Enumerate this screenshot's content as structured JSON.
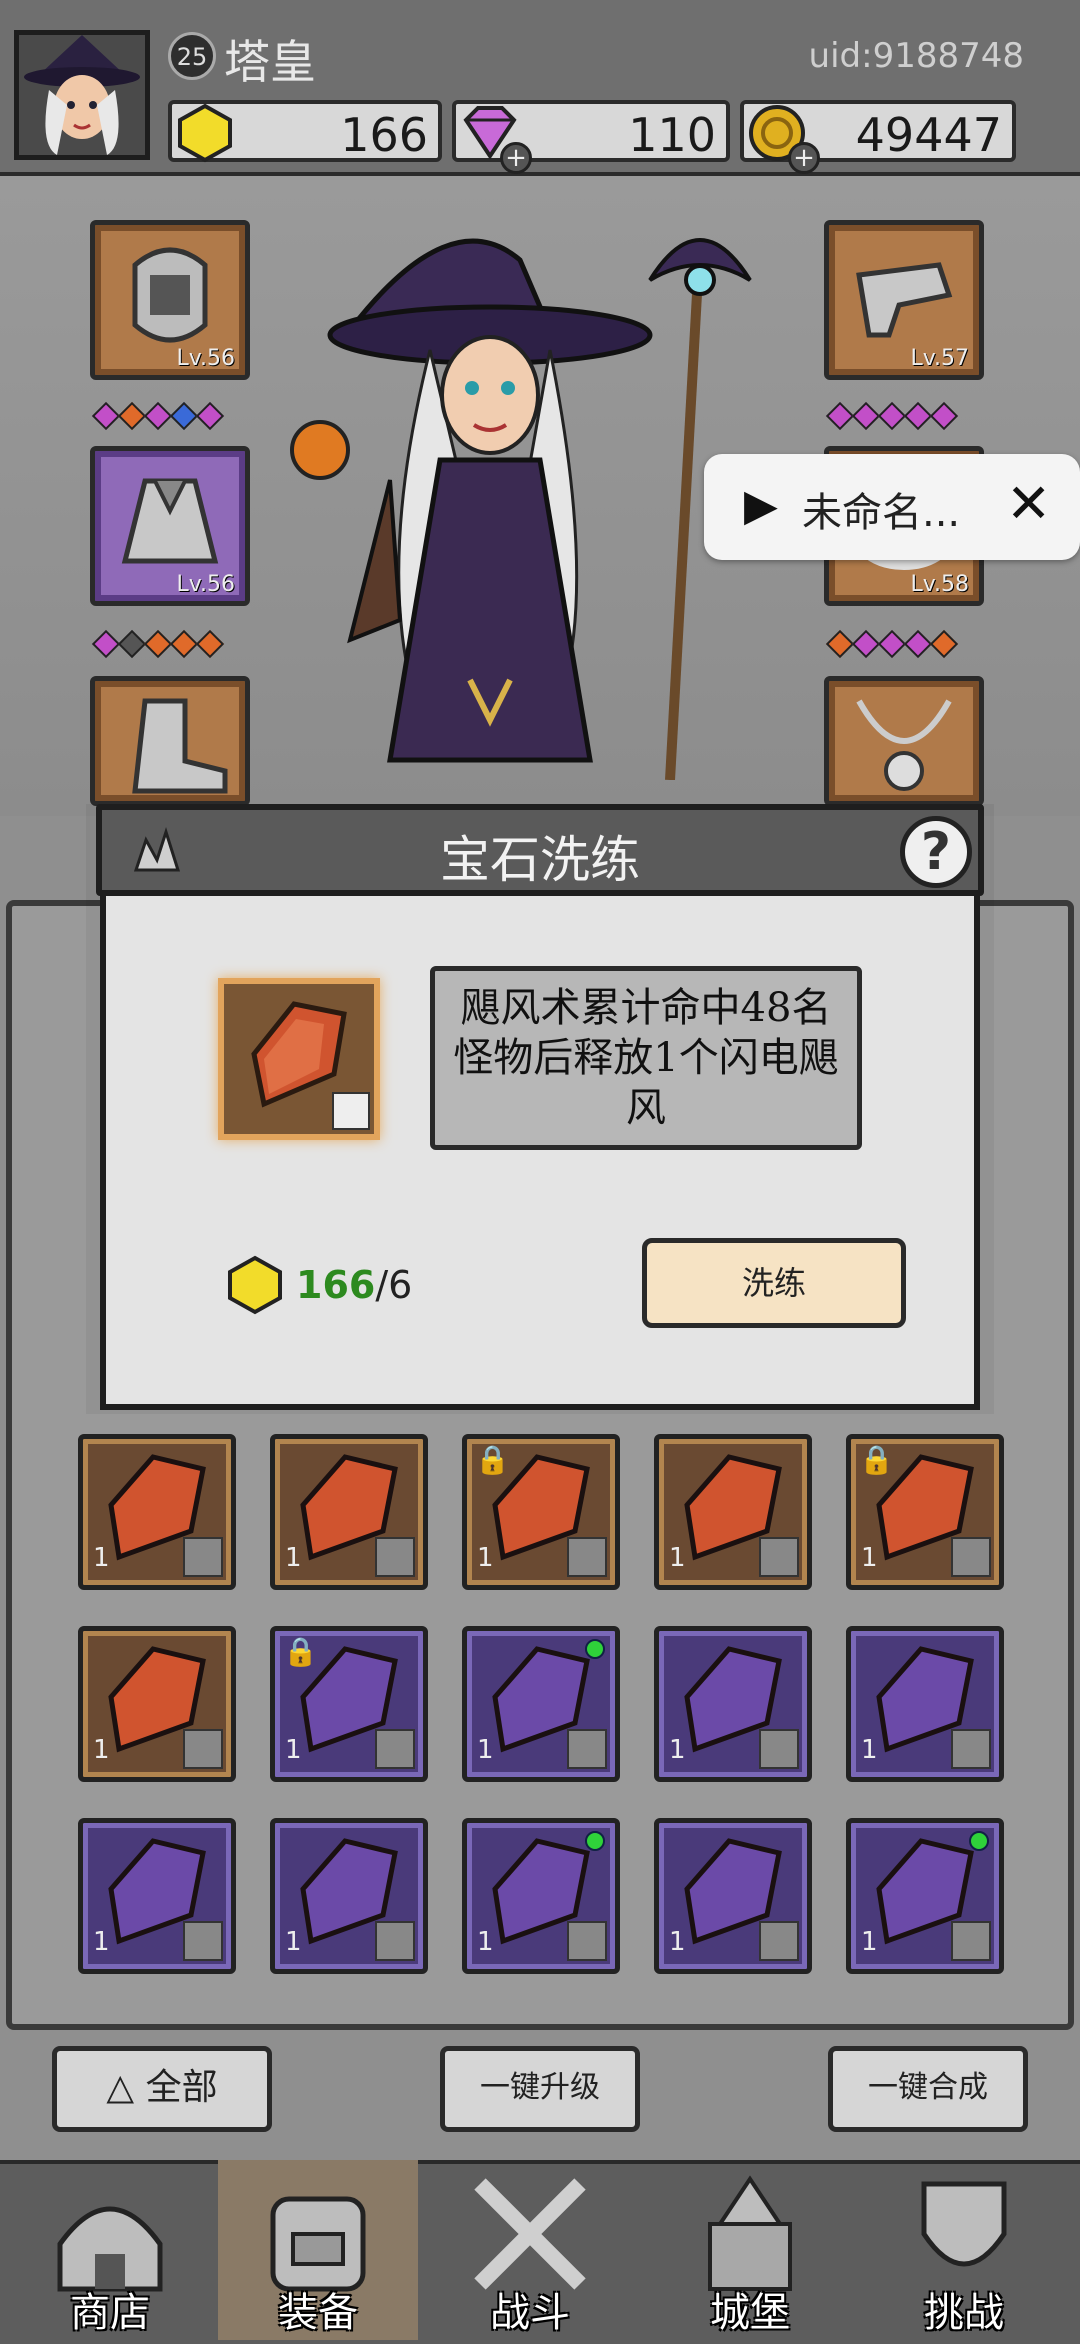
{
  "player": {
    "level": "25",
    "name": "塔皇",
    "uid": "uid:9188748"
  },
  "resources": {
    "gold_gem": "166",
    "diamond": "110",
    "coin": "49447"
  },
  "equipment_slots": [
    {
      "name": "helmet",
      "level": "Lv.56"
    },
    {
      "name": "cloak",
      "level": "Lv.56"
    },
    {
      "name": "boots",
      "level": ""
    },
    {
      "name": "gauntlet",
      "level": "Lv.57"
    },
    {
      "name": "ring",
      "level": "Lv.58"
    },
    {
      "name": "amulet",
      "level": ""
    }
  ],
  "notification": {
    "label": "未命名..."
  },
  "modal": {
    "title": "宝石洗练",
    "help": "?",
    "description": "飓风术累计命中48名怪物后释放1个闪电飓风",
    "cost_have": "166",
    "cost_need": "/6",
    "refine_button": "洗练"
  },
  "gem_grid": [
    {
      "color": "orange",
      "count": "1",
      "locked": false,
      "new": false
    },
    {
      "color": "orange",
      "count": "1",
      "locked": false,
      "new": false
    },
    {
      "color": "orange",
      "count": "1",
      "locked": true,
      "new": false
    },
    {
      "color": "orange",
      "count": "1",
      "locked": false,
      "new": false
    },
    {
      "color": "orange",
      "count": "1",
      "locked": true,
      "new": false
    },
    {
      "color": "orange",
      "count": "1",
      "locked": false,
      "new": false
    },
    {
      "color": "purple",
      "count": "1",
      "locked": true,
      "new": false
    },
    {
      "color": "purple",
      "count": "1",
      "locked": false,
      "new": true
    },
    {
      "color": "purple",
      "count": "1",
      "locked": false,
      "new": false
    },
    {
      "color": "purple",
      "count": "1",
      "locked": false,
      "new": false
    },
    {
      "color": "purple",
      "count": "1",
      "locked": false,
      "new": false
    },
    {
      "color": "purple",
      "count": "1",
      "locked": false,
      "new": false
    },
    {
      "color": "purple",
      "count": "1",
      "locked": false,
      "new": true
    },
    {
      "color": "purple",
      "count": "1",
      "locked": false,
      "new": false
    },
    {
      "color": "purple",
      "count": "1",
      "locked": false,
      "new": true
    }
  ],
  "bottom_buttons": {
    "filter": "全部",
    "upgrade_all": "一键升级",
    "merge_all": "一键合成"
  },
  "nav": {
    "shop": "商店",
    "equip": "装备",
    "battle": "战斗",
    "castle": "城堡",
    "challenge": "挑战"
  },
  "colors": {
    "orange_gem": "#d0542f",
    "purple_gem": "#6b4aa8",
    "cost_green": "#2d8a1f"
  }
}
